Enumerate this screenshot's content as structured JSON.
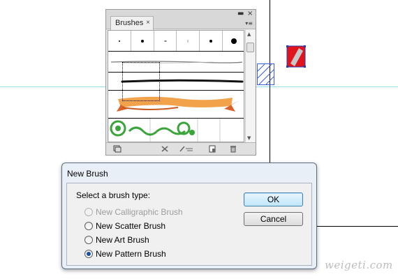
{
  "brushes_panel": {
    "tab_label": "Brushes",
    "close_glyph": "×",
    "minimize_glyph": "▬",
    "panel_close_glyph": "×",
    "menu_glyph": "▾≡",
    "tip_rows": [
      "tiny dot",
      "small dot",
      "dash",
      "thin stroke",
      "medium dot",
      "large dot"
    ]
  },
  "dialog": {
    "title": "New Brush",
    "prompt": "Select a brush type:",
    "options": [
      {
        "label": "New Calligraphic Brush",
        "checked": false,
        "disabled": true
      },
      {
        "label": "New Scatter Brush",
        "checked": false,
        "disabled": false
      },
      {
        "label": "New Art Brush",
        "checked": false,
        "disabled": false
      },
      {
        "label": "New Pattern Brush",
        "checked": true,
        "disabled": false
      }
    ],
    "ok_label": "OK",
    "cancel_label": "Cancel"
  },
  "watermark": "weigeti.com",
  "colors": {
    "guide": "#8fe0e8",
    "selection_red": "#e0141c",
    "hatch_blue": "#3a5fcd",
    "banner_orange": "#f2a24a",
    "vine_green": "#39a43a"
  }
}
